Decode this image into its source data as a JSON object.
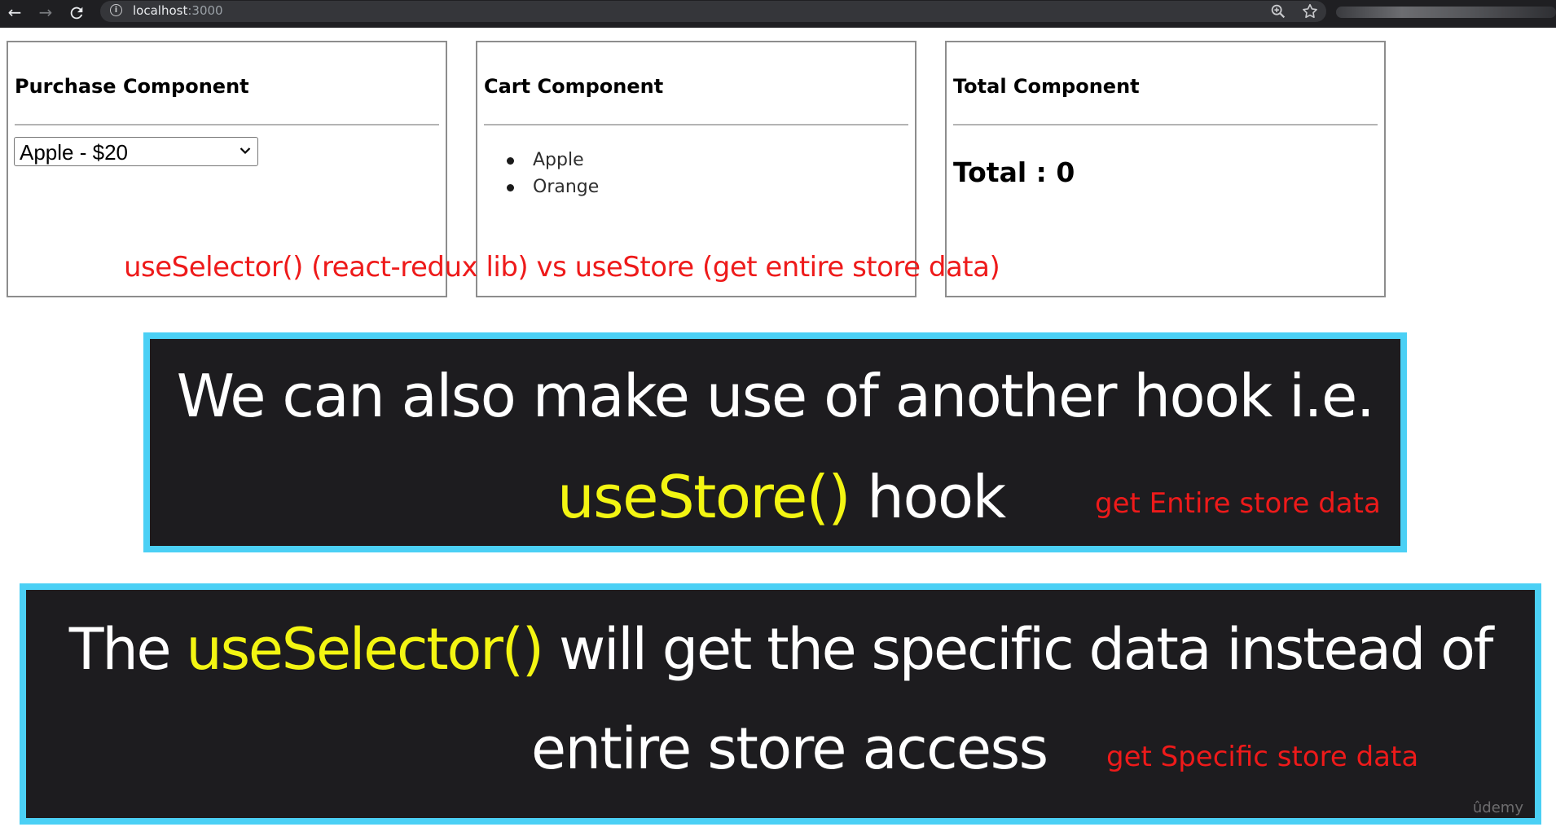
{
  "browser": {
    "url_host": "localhost",
    "url_port": ":3000",
    "back_icon": "arrow-left-icon",
    "forward_icon": "arrow-right-icon",
    "reload_icon": "reload-icon",
    "info_icon": "info-icon",
    "zoom_icon": "zoom-in-icon",
    "bookmark_icon": "star-icon"
  },
  "panels": {
    "purchase": {
      "title": "Purchase Component",
      "select_value": "Apple - $20"
    },
    "cart": {
      "title": "Cart Component",
      "items": [
        "Apple",
        "Orange"
      ]
    },
    "total": {
      "title": "Total Component",
      "total_text": "Total : 0"
    }
  },
  "annotation": "useSelector()  (react-redux lib) vs useStore (get entire store data)",
  "callout1": {
    "line1": "We can also make use of  another hook i.e.",
    "highlight": "useStore()",
    "line2_rest": " hook",
    "note": "get Entire store data"
  },
  "callout2": {
    "line1_start": "The ",
    "highlight": "useSelector()",
    "line1_rest": " will get the specific data instead of",
    "line2": "entire store access",
    "note": "get Specific store data"
  },
  "watermark": "ûdemy",
  "colors": {
    "callout_border": "#4bd0f5",
    "callout_bg": "#1d1c1f",
    "highlight_yellow": "#f3f512",
    "annotation_red": "#ee1a1a"
  }
}
